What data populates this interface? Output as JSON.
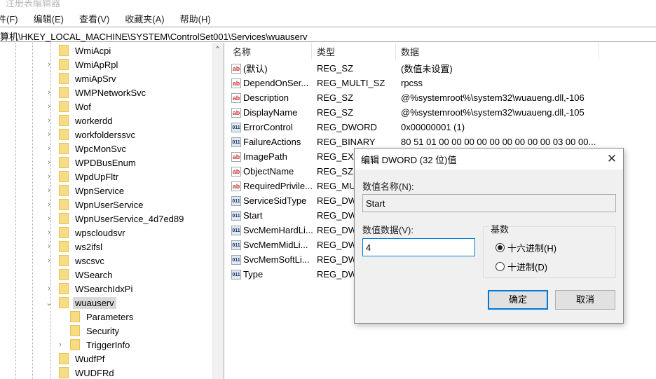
{
  "window": {
    "title": "注册表编辑器"
  },
  "menu": [
    "件(F)",
    "编辑(E)",
    "查看(V)",
    "收藏夹(A)",
    "帮助(H)"
  ],
  "address": "算机\\HKEY_LOCAL_MACHINE\\SYSTEM\\ControlSet001\\Services\\wuauserv",
  "tree": [
    {
      "label": "WmiAcpi",
      "level": 0,
      "expander": "none"
    },
    {
      "label": "WmiApRpl",
      "level": 0,
      "expander": "collapsed"
    },
    {
      "label": "wmiApSrv",
      "level": 0,
      "expander": "none"
    },
    {
      "label": "WMPNetworkSvc",
      "level": 0,
      "expander": "collapsed"
    },
    {
      "label": "Wof",
      "level": 0,
      "expander": "collapsed"
    },
    {
      "label": "workerdd",
      "level": 0,
      "expander": "collapsed"
    },
    {
      "label": "workfolderssvc",
      "level": 0,
      "expander": "collapsed"
    },
    {
      "label": "WpcMonSvc",
      "level": 0,
      "expander": "collapsed"
    },
    {
      "label": "WPDBusEnum",
      "level": 0,
      "expander": "collapsed"
    },
    {
      "label": "WpdUpFltr",
      "level": 0,
      "expander": "collapsed"
    },
    {
      "label": "WpnService",
      "level": 0,
      "expander": "collapsed"
    },
    {
      "label": "WpnUserService",
      "level": 0,
      "expander": "collapsed"
    },
    {
      "label": "WpnUserService_4d7ed89",
      "level": 0,
      "expander": "collapsed"
    },
    {
      "label": "wpscloudsvr",
      "level": 0,
      "expander": "collapsed"
    },
    {
      "label": "ws2ifsl",
      "level": 0,
      "expander": "collapsed"
    },
    {
      "label": "wscsvc",
      "level": 0,
      "expander": "collapsed"
    },
    {
      "label": "WSearch",
      "level": 0,
      "expander": "none"
    },
    {
      "label": "WSearchIdxPi",
      "level": 0,
      "expander": "collapsed"
    },
    {
      "label": "wuauserv",
      "level": 0,
      "expander": "expanded",
      "selected": true
    },
    {
      "label": "Parameters",
      "level": 1,
      "expander": "none"
    },
    {
      "label": "Security",
      "level": 1,
      "expander": "none"
    },
    {
      "label": "TriggerInfo",
      "level": 1,
      "expander": "collapsed"
    },
    {
      "label": "WudfPf",
      "level": 0,
      "expander": "none"
    },
    {
      "label": "WUDFRd",
      "level": 0,
      "expander": "none"
    }
  ],
  "columns": {
    "name": "名称",
    "type": "类型",
    "data": "数据"
  },
  "values": [
    {
      "icon": "string",
      "name": "(默认)",
      "type": "REG_SZ",
      "data": "(数值未设置)"
    },
    {
      "icon": "string",
      "name": "DependOnSer...",
      "type": "REG_MULTI_SZ",
      "data": "rpcss"
    },
    {
      "icon": "string",
      "name": "Description",
      "type": "REG_SZ",
      "data": "@%systemroot%\\system32\\wuaueng.dll,-106"
    },
    {
      "icon": "string",
      "name": "DisplayName",
      "type": "REG_SZ",
      "data": "@%systemroot%\\system32\\wuaueng.dll,-105"
    },
    {
      "icon": "binary",
      "name": "ErrorControl",
      "type": "REG_DWORD",
      "data": "0x00000001 (1)"
    },
    {
      "icon": "binary",
      "name": "FailureActions",
      "type": "REG_BINARY",
      "data": "80 51 01 00 00 00 00 00 00 00 00 00 03 00 00..."
    },
    {
      "icon": "string",
      "name": "ImagePath",
      "type": "REG_EXPA",
      "data": ""
    },
    {
      "icon": "string",
      "name": "ObjectName",
      "type": "REG_SZ",
      "data": ""
    },
    {
      "icon": "string",
      "name": "RequiredPrivile...",
      "type": "REG_MUL",
      "data": ""
    },
    {
      "icon": "binary",
      "name": "ServiceSidType",
      "type": "REG_DWO",
      "data": ""
    },
    {
      "icon": "binary",
      "name": "Start",
      "type": "REG_DWO",
      "data": ""
    },
    {
      "icon": "binary",
      "name": "SvcMemHardLi...",
      "type": "REG_DWO",
      "data": ""
    },
    {
      "icon": "binary",
      "name": "SvcMemMidLi...",
      "type": "REG_DWO",
      "data": ""
    },
    {
      "icon": "binary",
      "name": "SvcMemSoftLi...",
      "type": "REG_DWO",
      "data": ""
    },
    {
      "icon": "binary",
      "name": "Type",
      "type": "REG_DWO",
      "data": ""
    }
  ],
  "dialog": {
    "title": "编辑 DWORD (32 位)值",
    "name_label": "数值名称(N):",
    "name_value": "Start",
    "data_label": "数值数据(V):",
    "data_value": "4",
    "base_label": "基数",
    "hex_label": "十六进制(H)",
    "dec_label": "十进制(D)",
    "base_selected": "hex",
    "ok": "确定",
    "cancel": "取消"
  }
}
